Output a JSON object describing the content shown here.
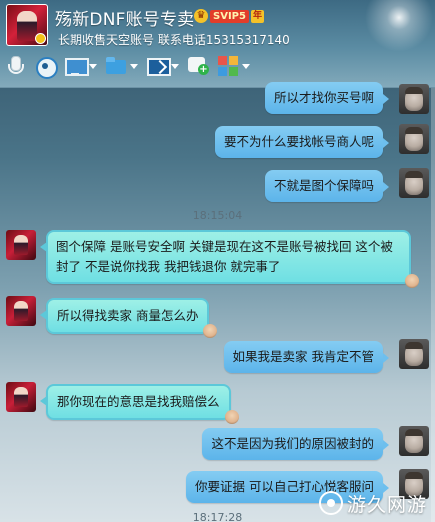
{
  "header": {
    "title": "殇新DNF账号专卖",
    "vip_badge": "SVIP5",
    "year_badge": "年",
    "subtitle": "长期收售天空账号   联系电话15315317140"
  },
  "toolbar": {
    "items": [
      {
        "icon": "microphone-icon"
      },
      {
        "icon": "webcam-icon"
      },
      {
        "icon": "screen-share-icon"
      },
      {
        "icon": "send-file-icon"
      },
      {
        "icon": "remote-assist-icon"
      },
      {
        "icon": "add-note-icon"
      },
      {
        "icon": "apps-grid-icon"
      }
    ]
  },
  "messages": [
    {
      "side": "out",
      "text": "所以才找你买号啊"
    },
    {
      "side": "out",
      "text": "要不为什么要找帐号商人呢"
    },
    {
      "side": "out",
      "text": "不就是图个保障吗"
    },
    {
      "side": "time",
      "text": "18:15:04"
    },
    {
      "side": "in",
      "text": "图个保障 是账号安全啊   关键是现在这不是账号被找回 这个被封了 不是说你找我 我把钱退你  就完事了"
    },
    {
      "side": "in",
      "text": "所以得找卖家 商量怎么办"
    },
    {
      "side": "out",
      "text": "如果我是卖家 我肯定不管"
    },
    {
      "side": "in",
      "text": "那你现在的意思是找我赔偿么"
    },
    {
      "side": "out",
      "text": "这不是因为我们的原因被封的"
    },
    {
      "side": "out",
      "text": "你要证据 可以自己打心悦客服问"
    },
    {
      "side": "time",
      "text": "18:17:28"
    }
  ],
  "watermark": {
    "text": "游久网游"
  },
  "colors": {
    "outgoing_bubble": "#5cb4ea",
    "incoming_bubble": "#7fe6e3",
    "header_bg": "#4a7a93"
  }
}
